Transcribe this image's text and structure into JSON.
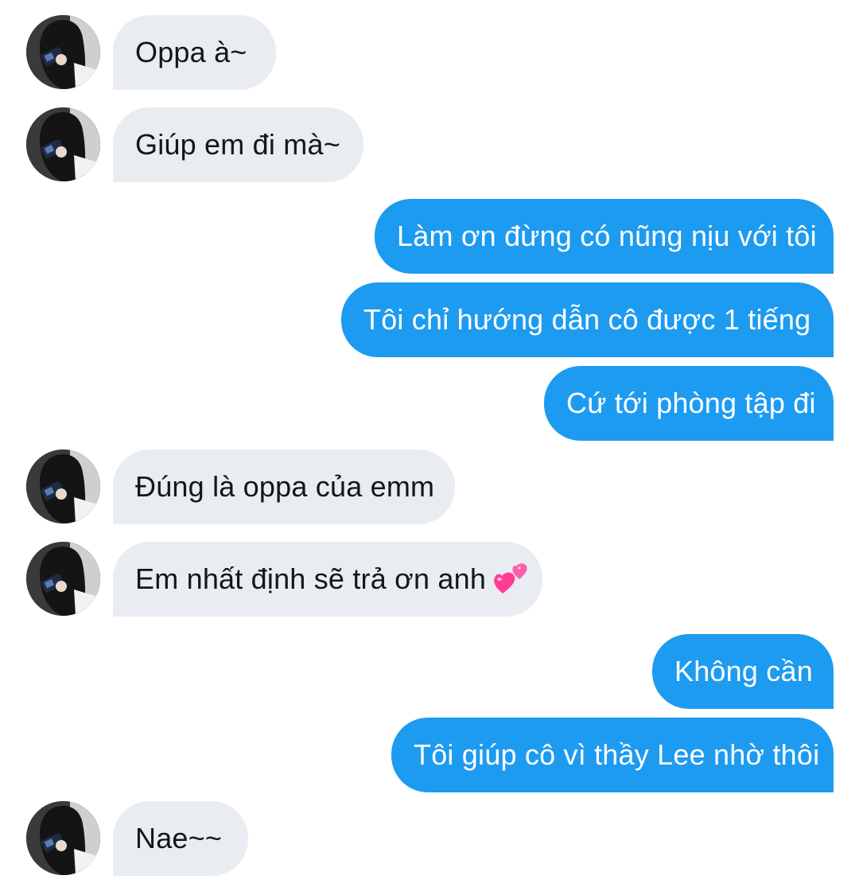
{
  "messages": [
    {
      "side": "in",
      "text": "Oppa à~"
    },
    {
      "side": "in",
      "text": "Giúp em đi mà~"
    },
    {
      "side": "out",
      "text": "Làm ơn đừng có nũng nịu với tôi"
    },
    {
      "side": "out",
      "text": "Tôi chỉ hướng dẫn cô được 1 tiếng"
    },
    {
      "side": "out",
      "text": "Cứ tới phòng tập đi"
    },
    {
      "side": "in",
      "text": "Đúng là oppa của emm"
    },
    {
      "side": "in",
      "text": "Em nhất định sẽ trả ơn anh",
      "emoji": "two-hearts-icon"
    },
    {
      "side": "out",
      "text": "Không cần"
    },
    {
      "side": "out",
      "text": "Tôi giúp cô vì thầy Lee nhờ thôi"
    },
    {
      "side": "in",
      "text": "Nae~~"
    }
  ],
  "colors": {
    "incoming_bubble": "#e9ecf0",
    "outgoing_bubble": "#1d9bf0",
    "incoming_text": "#14171a",
    "outgoing_text": "#ffffff"
  }
}
